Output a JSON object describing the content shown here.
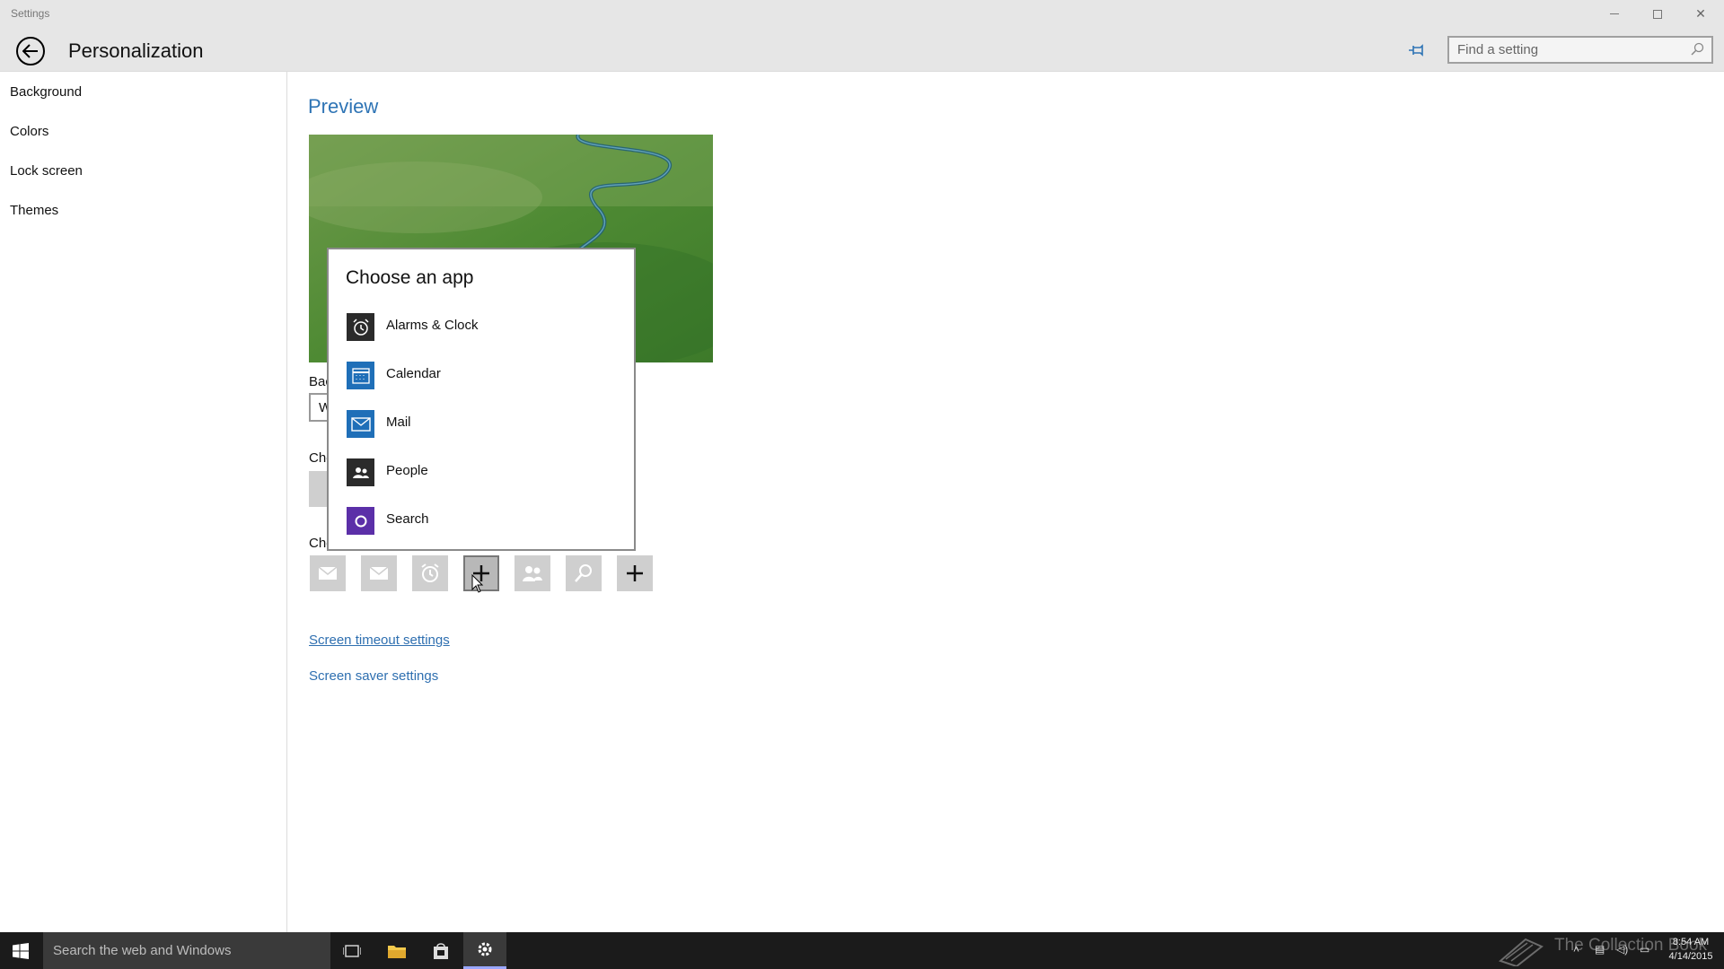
{
  "window": {
    "title": "Settings"
  },
  "header": {
    "title": "Personalization",
    "search_placeholder": "Find a setting"
  },
  "sidebar": {
    "items": [
      {
        "label": "Background"
      },
      {
        "label": "Colors"
      },
      {
        "label": "Lock screen"
      },
      {
        "label": "Themes"
      }
    ]
  },
  "main": {
    "section_title": "Preview",
    "partial_labels": {
      "background": "Bac",
      "background_value": "W",
      "choose_detailed": "Che",
      "choose_quick": "Che"
    },
    "links": {
      "timeout": "Screen timeout settings",
      "saver": "Screen saver settings"
    },
    "quick_status_icons": [
      "mail-icon",
      "mail-icon",
      "alarm-clock-icon",
      "add-icon",
      "people-icon",
      "search-icon",
      "add-icon"
    ]
  },
  "popup": {
    "title": "Choose an app",
    "apps": [
      {
        "label": "Alarms & Clock",
        "icon": "alarm-clock-icon",
        "color": "#2b2b2b"
      },
      {
        "label": "Calendar",
        "icon": "calendar-icon",
        "color": "#1f6fb8"
      },
      {
        "label": "Mail",
        "icon": "mail-icon",
        "color": "#1f6fb8"
      },
      {
        "label": "People",
        "icon": "people-icon",
        "color": "#2b2b2b"
      },
      {
        "label": "Search",
        "icon": "search-circle-icon",
        "color": "#5b2fa8"
      }
    ]
  },
  "taskbar": {
    "search_placeholder": "Search the web and Windows",
    "watermark": "The Collection Book",
    "time": "8:54 AM",
    "date": "4/14/2015"
  },
  "colors": {
    "accent": "#2e74b5",
    "taskbar": "#1b1b1b",
    "chrome": "#e6e6e6"
  }
}
